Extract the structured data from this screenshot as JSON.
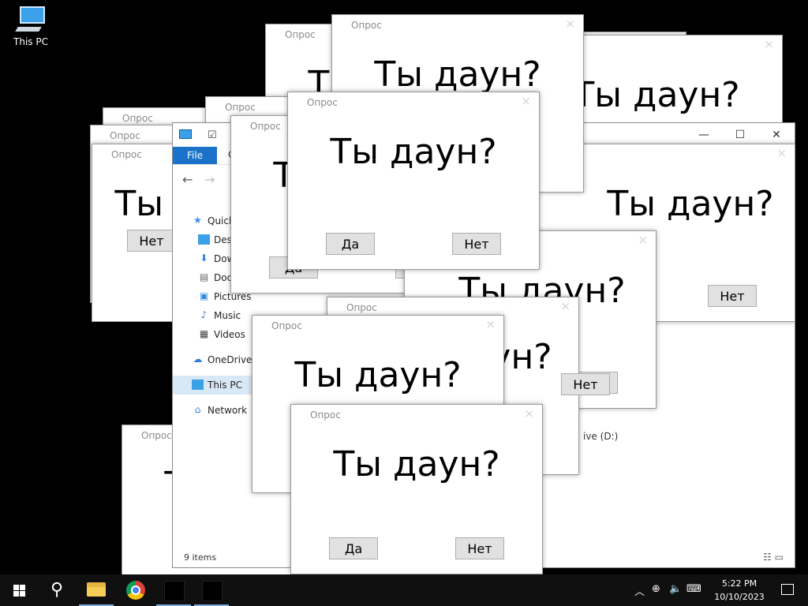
{
  "desktop": {
    "icon_label": "This PC"
  },
  "explorer": {
    "ribbon_file": "File",
    "ribbon_tab_fragment": "C",
    "nav": [
      {
        "label": "Quick access",
        "icon": "star-icon"
      },
      {
        "label": "Desktop",
        "icon": "desktop-icon"
      },
      {
        "label": "Downloads",
        "icon": "download-icon"
      },
      {
        "label": "Documents",
        "icon": "documents-icon"
      },
      {
        "label": "Pictures",
        "icon": "pictures-icon"
      },
      {
        "label": "Music",
        "icon": "music-icon"
      },
      {
        "label": "Videos",
        "icon": "videos-icon"
      },
      {
        "label": "OneDrive",
        "icon": "cloud-icon"
      },
      {
        "label": "This PC",
        "icon": "computer-icon"
      },
      {
        "label": "Network",
        "icon": "network-icon"
      }
    ],
    "drive_label": "ive (D:)",
    "status": "9 items"
  },
  "dialog": {
    "title": "Опрос",
    "question": "Ты даун?",
    "yes": "Да",
    "no": "Нет"
  },
  "taskbar": {
    "time": "5:22 PM",
    "date": "10/10/2023"
  },
  "colors": {
    "accent": "#1a73c8",
    "taskbar": "#101010"
  }
}
